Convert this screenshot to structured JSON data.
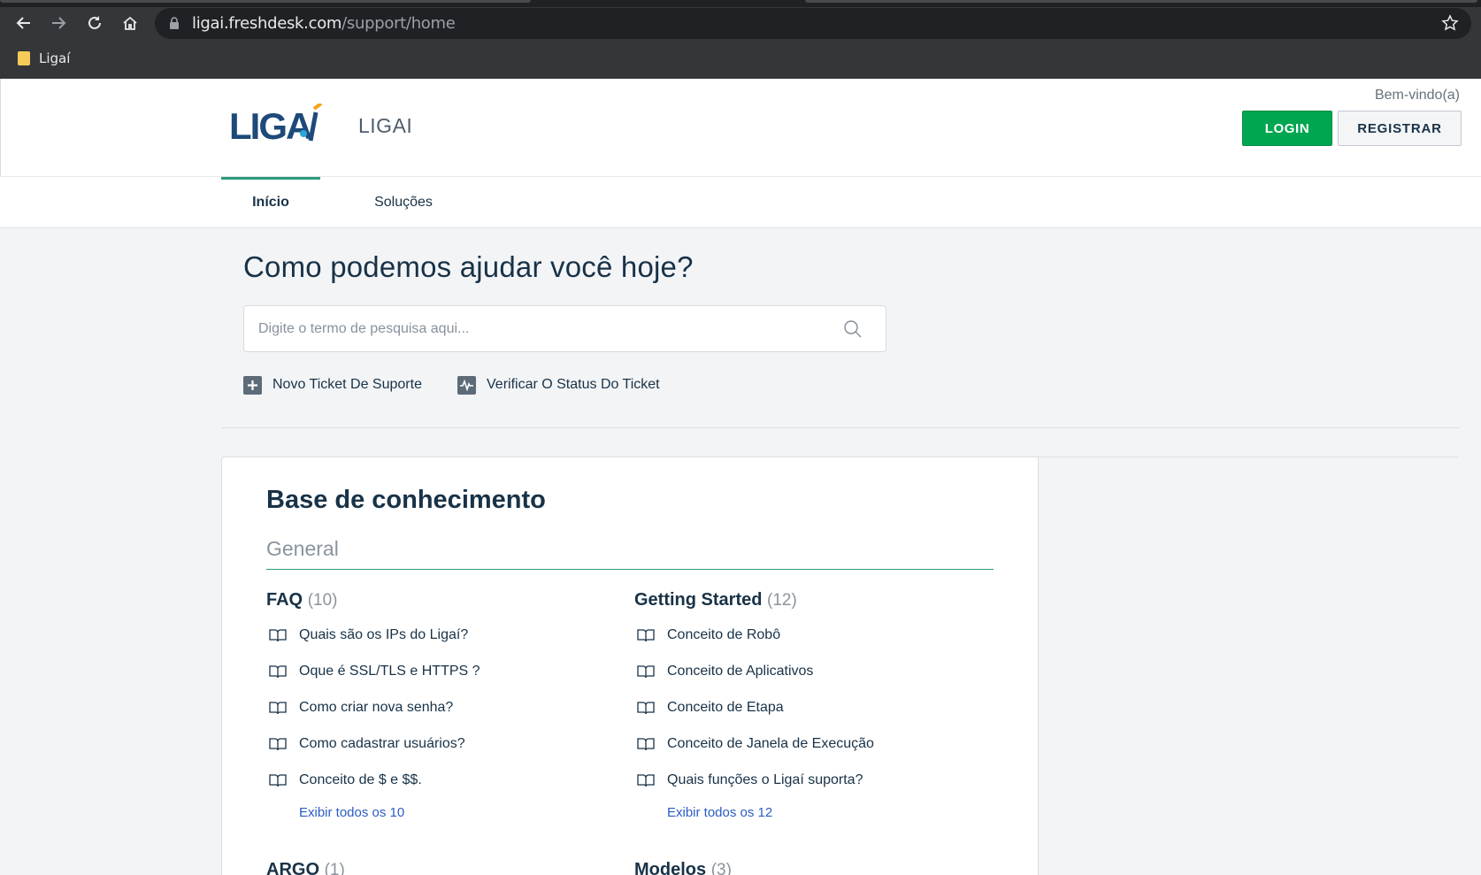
{
  "browser": {
    "url_host": "ligai.freshdesk.com",
    "url_path": "/support/home",
    "bookmark": "Ligaí"
  },
  "header": {
    "logo_text": "LIGAÍ",
    "portal_name": "LIGAI",
    "welcome": "Bem-vindo(a)",
    "login_label": "LOGIN",
    "register_label": "REGISTRAR",
    "accent_color": "#00a650"
  },
  "tabs": [
    {
      "label": "Início",
      "active": true
    },
    {
      "label": "Soluções",
      "active": false
    }
  ],
  "hero": {
    "title": "Como podemos ajudar você hoje?",
    "search_placeholder": "Digite o termo de pesquisa aqui...",
    "actions": [
      {
        "label": "Novo Ticket De Suporte",
        "icon": "plus-square-icon"
      },
      {
        "label": "Verificar O Status Do Ticket",
        "icon": "pulse-icon"
      }
    ]
  },
  "knowledge_base": {
    "title": "Base de conhecimento",
    "category": "General",
    "folders": [
      {
        "name": "FAQ",
        "count": "(10)",
        "articles": [
          "Quais são os IPs do Ligaí?",
          "Oque é SSL/TLS e HTTPS ?",
          "Como criar nova senha?",
          "Como cadastrar usuários?",
          "Conceito de $ e $$."
        ],
        "view_all": "Exibir todos os 10"
      },
      {
        "name": "Getting Started",
        "count": "(12)",
        "articles": [
          "Conceito de Robô",
          "Conceito de Aplicativos",
          "Conceito de Etapa",
          "Conceito de Janela de Execução",
          "Quais funções o Ligaí suporta?"
        ],
        "view_all": "Exibir todos os 12"
      }
    ],
    "next_folders": [
      {
        "name": "ARGO",
        "count": "(1)"
      },
      {
        "name": "Modelos",
        "count": "(3)"
      }
    ]
  }
}
